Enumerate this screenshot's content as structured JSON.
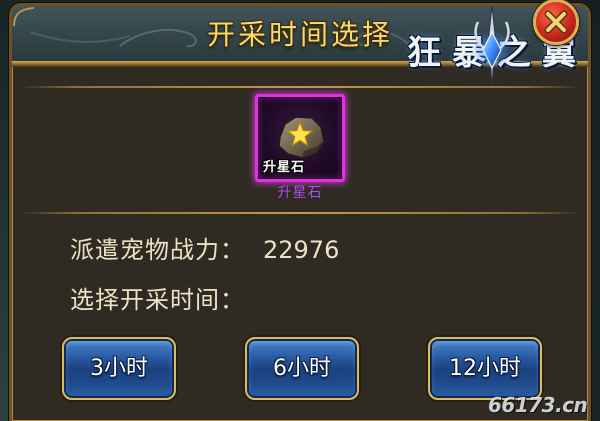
{
  "window": {
    "title": "开采时间选择"
  },
  "logo": {
    "text": "狂暴之翼",
    "emblem_icon": "winged-crystal-emblem-icon"
  },
  "close_button": {
    "icon": "close-x-icon"
  },
  "item": {
    "icon": "star-stone-icon",
    "icon_caption": "升星石",
    "name": "升星石"
  },
  "info": {
    "power_label": "派遣宠物战力：",
    "power_value": "22976",
    "select_time_label": "选择开采时间："
  },
  "duration_buttons": [
    {
      "label": "3小时"
    },
    {
      "label": "6小时"
    },
    {
      "label": "12小时"
    }
  ],
  "watermark": "66173.cn",
  "colors": {
    "title": "#f6d86c",
    "text": "#ece3c6",
    "item_name": "#a94ff0",
    "item_border": "#e42fe8",
    "button_face": "#2a5ca6",
    "close_button": "#c9261c",
    "frame_gold": "#b08a42",
    "body_bg": "#2f2b23"
  }
}
